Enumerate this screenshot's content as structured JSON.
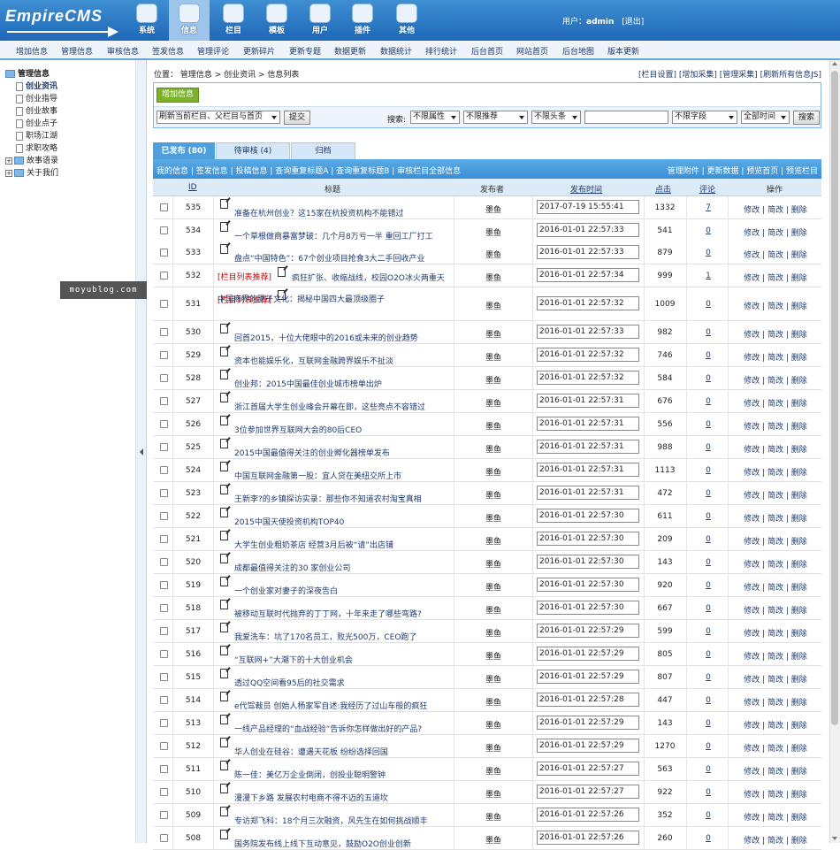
{
  "brand": {
    "logo_text": "EmpireCMS"
  },
  "topnav": [
    {
      "label": "系统",
      "icon": "globe-icon"
    },
    {
      "label": "信息",
      "icon": "edit-icon",
      "active": true
    },
    {
      "label": "栏目",
      "icon": "folder-icon"
    },
    {
      "label": "模板",
      "icon": "template-icon"
    },
    {
      "label": "用户",
      "icon": "user-icon"
    },
    {
      "label": "插件",
      "icon": "tools-icon"
    },
    {
      "label": "其他",
      "icon": "gear-icon"
    }
  ],
  "user": {
    "prefix": "用户：",
    "name": "admin",
    "logout": "[退出]"
  },
  "subnav": [
    "增加信息",
    "管理信息",
    "审核信息",
    "签发信息",
    "管理评论",
    "更新碎片",
    "更新专题",
    "数据更新",
    "数据统计",
    "排行统计",
    "后台首页",
    "网站首页",
    "后台地图",
    "版本更新"
  ],
  "tree": {
    "root": "管理信息",
    "items": [
      "创业资讯",
      "创业指导",
      "创业故事",
      "创业点子",
      "职场江湖",
      "求职攻略"
    ],
    "folders": [
      "故事语录",
      "关于我们"
    ]
  },
  "watermark": "moyublog.com",
  "breadcrumb": "位置： 管理信息 > 创业资讯 > 信息列表",
  "toplinks": "[栏目设置] [增加采集] [管理采集] [刷新所有信息JS]",
  "add_button": "增加信息",
  "refresh_select": "刷新当前栏目、父栏目与首页",
  "submit": "提交",
  "search": {
    "label": "搜索:",
    "attr": "不限属性",
    "recommend": "不限推荐",
    "headline": "不限头条",
    "field": "不限字段",
    "time": "全部时间",
    "button": "搜索"
  },
  "tabs": [
    "已发布 (80)",
    "待审核 (4)",
    "归档"
  ],
  "toolbar": {
    "left": "我的信息 | 签发信息 | 投稿信息 | 查询重复标题A | 查询重复标题B | 审核栏目全部信息",
    "right": "管理附件 | 更新数据 | 预览首页 | 预览栏目"
  },
  "headers": {
    "id": "ID",
    "title": "标题",
    "publisher": "发布者",
    "time": "发布时间",
    "clicks": "点击",
    "comments": "评论",
    "ops": "操作"
  },
  "rows": [
    {
      "id": "535",
      "tag": "",
      "title": "准备在杭州创业？这15家在杭投资机构不能错过",
      "pub": "墨鱼",
      "time": "2017-07-19 15:55:41",
      "clicks": "1332",
      "cmt": "7"
    },
    {
      "id": "534",
      "tag": "",
      "title": "一个草根做商暴富梦破：几个月8万亏一半 重回工厂打工",
      "pub": "墨鱼",
      "time": "2016-01-01 22:57:33",
      "clicks": "541",
      "cmt": "0"
    },
    {
      "id": "533",
      "tag": "",
      "title": "盘点“中国特色”：67个创业项目抢食3大二手回收产业",
      "pub": "墨鱼",
      "time": "2016-01-01 22:57:33",
      "clicks": "879",
      "cmt": "0"
    },
    {
      "id": "532",
      "tag": "[栏目列表推荐]",
      "title": "疯狂扩张、收缩战线，校园O2O冰火两重天",
      "pub": "墨鱼",
      "time": "2016-01-01 22:57:34",
      "clicks": "999",
      "cmt": "1"
    },
    {
      "id": "531",
      "tag": "[栏目列表推荐]",
      "title": "中国商界的圈子文化：揭秘中国四大最顶级圈子",
      "pub": "墨鱼",
      "time": "2016-01-01 22:57:32",
      "clicks": "1009",
      "cmt": "0"
    },
    {
      "id": "530",
      "tag": "",
      "title": "回首2015，十位大佬眼中的2016或未来的创业趋势",
      "pub": "墨鱼",
      "time": "2016-01-01 22:57:33",
      "clicks": "982",
      "cmt": "0"
    },
    {
      "id": "529",
      "tag": "",
      "title": "资本也能娱乐化，互联网金融跨界娱乐不扯淡",
      "pub": "墨鱼",
      "time": "2016-01-01 22:57:32",
      "clicks": "746",
      "cmt": "0"
    },
    {
      "id": "528",
      "tag": "",
      "title": "创业邦：2015中国最佳创业城市榜单出炉",
      "pub": "墨鱼",
      "time": "2016-01-01 22:57:32",
      "clicks": "584",
      "cmt": "0"
    },
    {
      "id": "527",
      "tag": "",
      "title": "浙江首届大学生创业峰会开幕在即，这些亮点不容错过",
      "pub": "墨鱼",
      "time": "2016-01-01 22:57:31",
      "clicks": "676",
      "cmt": "0"
    },
    {
      "id": "526",
      "tag": "",
      "title": "3位参加世界互联网大会的80后CEO",
      "pub": "墨鱼",
      "time": "2016-01-01 22:57:31",
      "clicks": "556",
      "cmt": "0"
    },
    {
      "id": "525",
      "tag": "",
      "title": "2015中国最值得关注的创业孵化器榜单发布",
      "pub": "墨鱼",
      "time": "2016-01-01 22:57:31",
      "clicks": "988",
      "cmt": "0"
    },
    {
      "id": "524",
      "tag": "",
      "title": "中国互联网金融第一股：宜人贷在美纽交所上市",
      "pub": "墨鱼",
      "time": "2016-01-01 22:57:31",
      "clicks": "1113",
      "cmt": "0"
    },
    {
      "id": "523",
      "tag": "",
      "title": "王新李?的乡镇探访实录：那些你不知道农村淘宝真相",
      "pub": "墨鱼",
      "time": "2016-01-01 22:57:31",
      "clicks": "472",
      "cmt": "0"
    },
    {
      "id": "522",
      "tag": "",
      "title": "2015中国天使投资机构TOP40",
      "pub": "墨鱼",
      "time": "2016-01-01 22:57:30",
      "clicks": "611",
      "cmt": "0"
    },
    {
      "id": "521",
      "tag": "",
      "title": "大学生创业粗奶茶店 经营3月后被“请”出店铺",
      "pub": "墨鱼",
      "time": "2016-01-01 22:57:30",
      "clicks": "209",
      "cmt": "0"
    },
    {
      "id": "520",
      "tag": "",
      "title": "成都最值得关注的30 家创业公司",
      "pub": "墨鱼",
      "time": "2016-01-01 22:57:30",
      "clicks": "143",
      "cmt": "0"
    },
    {
      "id": "519",
      "tag": "",
      "title": "一个创业家对妻子的深夜告白",
      "pub": "墨鱼",
      "time": "2016-01-01 22:57:30",
      "clicks": "920",
      "cmt": "0"
    },
    {
      "id": "518",
      "tag": "",
      "title": "被移动互联时代抛弃的丁丁网，十年来走了哪些弯路?",
      "pub": "墨鱼",
      "time": "2016-01-01 22:57:30",
      "clicks": "667",
      "cmt": "0"
    },
    {
      "id": "517",
      "tag": "",
      "title": "我爱洗车：坑了170名员工，败光500万，CEO跑了",
      "pub": "墨鱼",
      "time": "2016-01-01 22:57:29",
      "clicks": "599",
      "cmt": "0"
    },
    {
      "id": "516",
      "tag": "",
      "title": "“互联网+”大潮下的十大创业机会",
      "pub": "墨鱼",
      "time": "2016-01-01 22:57:29",
      "clicks": "805",
      "cmt": "0"
    },
    {
      "id": "515",
      "tag": "",
      "title": "透过QQ空间看95后的社交需求",
      "pub": "墨鱼",
      "time": "2016-01-01 22:57:29",
      "clicks": "807",
      "cmt": "0"
    },
    {
      "id": "514",
      "tag": "",
      "title": "e代驾裁员 创始人杨家军自述:我经历了过山车般的疯狂",
      "pub": "墨鱼",
      "time": "2016-01-01 22:57:28",
      "clicks": "447",
      "cmt": "0"
    },
    {
      "id": "513",
      "tag": "",
      "title": "一线产品经理的“血战经验”告诉你怎样做出好的产品?",
      "pub": "墨鱼",
      "time": "2016-01-01 22:57:29",
      "clicks": "143",
      "cmt": "0"
    },
    {
      "id": "512",
      "tag": "",
      "title": "华人创业在硅谷：遭遇天花板 纷纷选择回国",
      "pub": "墨鱼",
      "time": "2016-01-01 22:57:29",
      "clicks": "1270",
      "cmt": "0"
    },
    {
      "id": "511",
      "tag": "",
      "title": "陈一佳：美亿万企业倒闭，创投业聪明警钟",
      "pub": "墨鱼",
      "time": "2016-01-01 22:57:27",
      "clicks": "563",
      "cmt": "0"
    },
    {
      "id": "510",
      "tag": "",
      "title": "漫漫下乡路 发展农村电商不得不迈的五道坎",
      "pub": "墨鱼",
      "time": "2016-01-01 22:57:27",
      "clicks": "922",
      "cmt": "0"
    },
    {
      "id": "509",
      "tag": "",
      "title": "专访郑飞科：18个月三次融资，风先生在如何挑战顺丰",
      "pub": "墨鱼",
      "time": "2016-01-01 22:57:26",
      "clicks": "352",
      "cmt": "0"
    },
    {
      "id": "508",
      "tag": "",
      "title": "国务院发布线上线下互动意见，鼓励O2O创业创新",
      "pub": "墨鱼",
      "time": "2016-01-01 22:57:26",
      "clicks": "260",
      "cmt": "0"
    }
  ],
  "ops": "修改 | 简改 | 删除"
}
